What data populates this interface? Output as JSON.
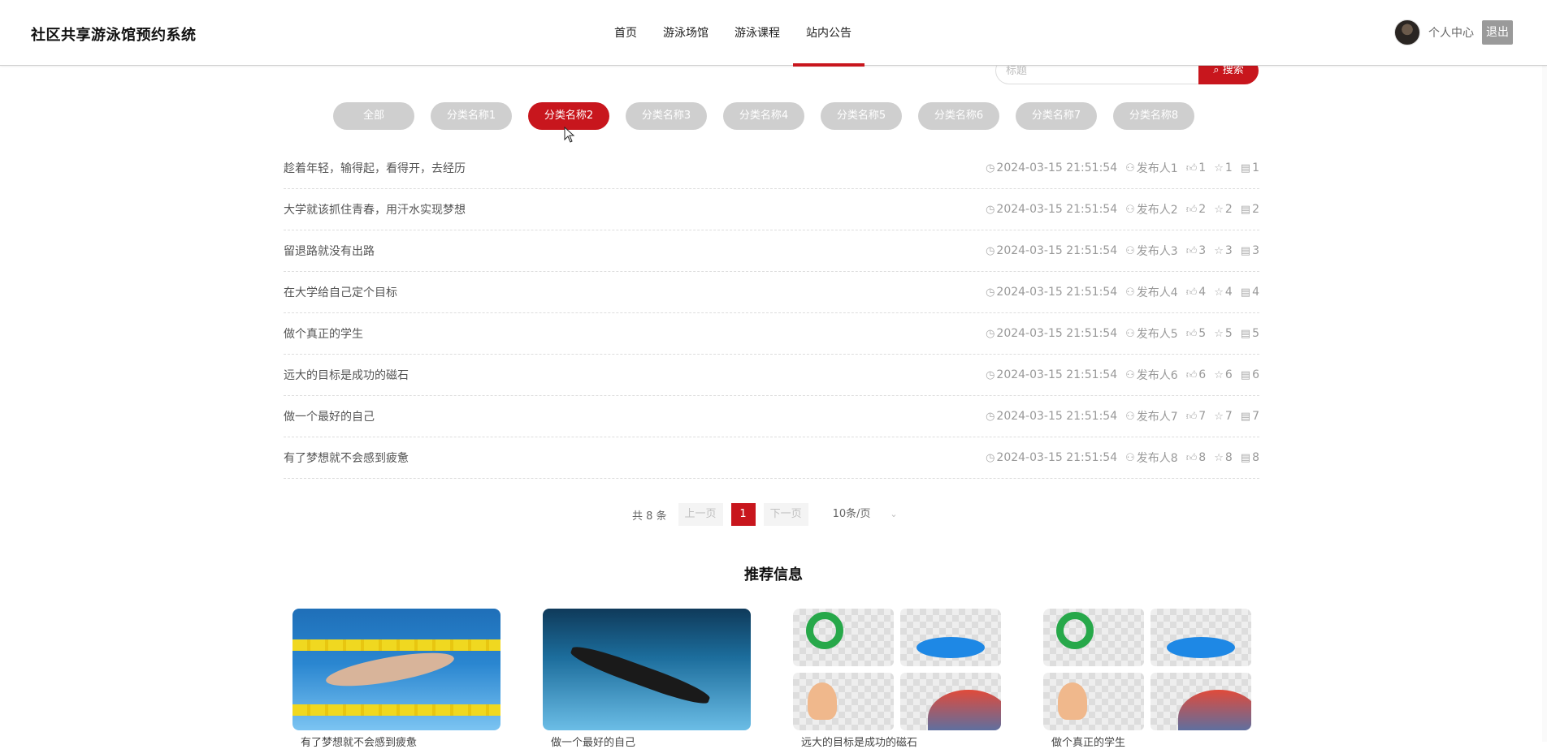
{
  "header": {
    "brand": "社区共享游泳馆预约系统",
    "nav": [
      "首页",
      "游泳场馆",
      "游泳课程",
      "站内公告"
    ],
    "active_nav": "站内公告",
    "user_center": "个人中心",
    "logout": "退出"
  },
  "search": {
    "placeholder": "标题",
    "button": "搜索"
  },
  "categories": [
    "全部",
    "分类名称1",
    "分类名称2",
    "分类名称3",
    "分类名称4",
    "分类名称5",
    "分类名称6",
    "分类名称7",
    "分类名称8"
  ],
  "active_category": "分类名称2",
  "notices": [
    {
      "title": "趁着年轻，输得起，看得开，去经历",
      "time": "2024-03-15 21:51:54",
      "author": "发布人1",
      "likes": "1",
      "favs": "1",
      "comments": "1"
    },
    {
      "title": "大学就该抓住青春，用汗水实现梦想",
      "time": "2024-03-15 21:51:54",
      "author": "发布人2",
      "likes": "2",
      "favs": "2",
      "comments": "2"
    },
    {
      "title": "留退路就没有出路",
      "time": "2024-03-15 21:51:54",
      "author": "发布人3",
      "likes": "3",
      "favs": "3",
      "comments": "3"
    },
    {
      "title": "在大学给自己定个目标",
      "time": "2024-03-15 21:51:54",
      "author": "发布人4",
      "likes": "4",
      "favs": "4",
      "comments": "4"
    },
    {
      "title": "做个真正的学生",
      "time": "2024-03-15 21:51:54",
      "author": "发布人5",
      "likes": "5",
      "favs": "5",
      "comments": "5"
    },
    {
      "title": "远大的目标是成功的磁石",
      "time": "2024-03-15 21:51:54",
      "author": "发布人6",
      "likes": "6",
      "favs": "6",
      "comments": "6"
    },
    {
      "title": "做一个最好的自己",
      "time": "2024-03-15 21:51:54",
      "author": "发布人7",
      "likes": "7",
      "favs": "7",
      "comments": "7"
    },
    {
      "title": "有了梦想就不会感到疲惫",
      "time": "2024-03-15 21:51:54",
      "author": "发布人8",
      "likes": "8",
      "favs": "8",
      "comments": "8"
    }
  ],
  "pagination": {
    "total": "共 8 条",
    "prev": "上一页",
    "current": "1",
    "next": "下一页",
    "page_size": "10条/页"
  },
  "recommend": {
    "title": "推荐信息",
    "items": [
      "有了梦想就不会感到疲惫",
      "做一个最好的自己",
      "远大的目标是成功的磁石",
      "做个真正的学生"
    ]
  },
  "colors": {
    "accent": "#c8161d",
    "inactive_pill": "#cfcfcf"
  }
}
